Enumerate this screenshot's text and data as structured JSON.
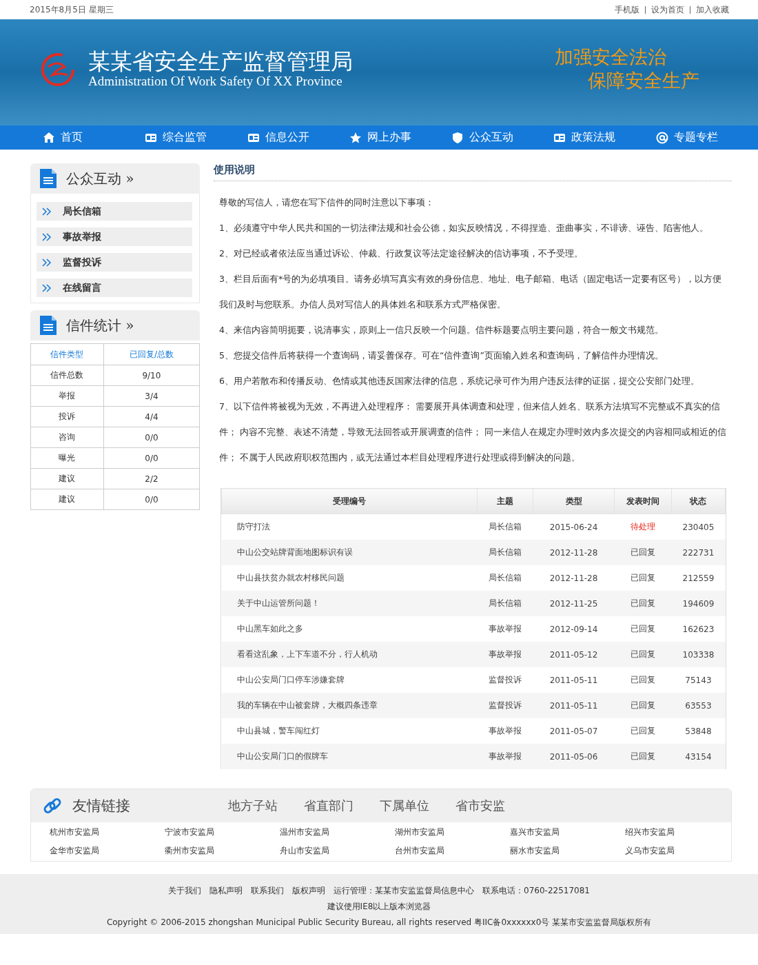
{
  "top_bar": {
    "date": "2015年8月5日 星期三",
    "links": [
      "手机版",
      "设为首页",
      "加入收藏"
    ]
  },
  "banner": {
    "title": "某某省安全生产监督管理局",
    "subtitle": "Administration Of Work Safety Of XX Province",
    "slogan": [
      "加强安全法治",
      "保障安全生产"
    ]
  },
  "nav": [
    {
      "label": "首页"
    },
    {
      "label": "综合监管"
    },
    {
      "label": "信息公开"
    },
    {
      "label": "网上办事"
    },
    {
      "label": "公众互动"
    },
    {
      "label": "政策法规"
    },
    {
      "label": "专题专栏"
    }
  ],
  "sidebar": {
    "menu_title": "公众互动 »",
    "menu": [
      "局长信箱",
      "事故举报",
      "监督投诉",
      "在线留言"
    ],
    "stats_title": "信件统计 »",
    "stats_columns": [
      "信件类型",
      "已回复/总数"
    ],
    "stats_rows": [
      [
        "信件总数",
        "9/10"
      ],
      [
        "举报",
        "3/4"
      ],
      [
        "投诉",
        "4/4"
      ],
      [
        "咨询",
        "0/0"
      ],
      [
        "曝光",
        "0/0"
      ],
      [
        "建议",
        "2/2"
      ],
      [
        "建议",
        "0/0"
      ]
    ]
  },
  "main": {
    "title": "使用说明",
    "paragraphs": [
      "尊敬的写信人，请您在写下信件的同时注意以下事项：",
      "1、必须遵守中华人民共和国的一切法律法规和社会公德，如实反映情况，不得捏造、歪曲事实，不诽谤、诬告、陷害他人。",
      "2、对已经或者依法应当通过诉讼、仲裁、行政复议等法定途径解决的信访事项，不予受理。",
      "3、栏目后面有*号的为必填项目。请务必填写真实有效的身份信息、地址、电子邮箱、电话（固定电话一定要有区号），以方便我们及时与您联系。办信人员对写信人的具体姓名和联系方式严格保密。",
      "4、来信内容简明扼要，说清事实，原则上一信只反映一个问题。信件标题要点明主要问题，符合一般文书规范。",
      "5、您提交信件后将获得一个查询码，请妥善保存。可在“信件查询”页面输入姓名和查询码，了解信件办理情况。",
      "6、用户若散布和传播反动、色情或其他违反国家法律的信息，系统记录可作为用户违反法律的证据，提交公安部门处理。",
      "7、以下信件将被视为无效，不再进入处理程序： 需要展开具体调查和处理，但来信人姓名、联系方法填写不完整或不真实的信件； 内容不完整、表述不清楚，导致无法回答或开展调查的信件； 同一来信人在规定办理时效内多次提交的内容相同或相近的信件； 不属于人民政府职权范围内，或无法通过本栏目处理程序进行处理或得到解决的问题。"
    ]
  },
  "table": {
    "columns": [
      "受理编号",
      "主题",
      "类型",
      "发表时间",
      "状态"
    ],
    "rows": [
      {
        "cells": [
          "防守打法",
          "局长信箱",
          "2015-06-24",
          "待处理",
          "230405"
        ],
        "pending": true
      },
      {
        "cells": [
          "中山公交站牌背面地图标识有误",
          "局长信箱",
          "2012-11-28",
          "已回复",
          "222731"
        ],
        "pending": false
      },
      {
        "cells": [
          "中山县扶贫办就农村移民问题",
          "局长信箱",
          "2012-11-28",
          "已回复",
          "212559"
        ],
        "pending": false
      },
      {
        "cells": [
          "关于中山运管所问题！",
          "局长信箱",
          "2012-11-25",
          "已回复",
          "194609"
        ],
        "pending": false
      },
      {
        "cells": [
          "中山黑车如此之多",
          "事故举报",
          "2012-09-14",
          "已回复",
          "162623"
        ],
        "pending": false
      },
      {
        "cells": [
          "看看这乱象，上下车道不分，行人机动",
          "事故举报",
          "2011-05-12",
          "已回复",
          "103338"
        ],
        "pending": false
      },
      {
        "cells": [
          "中山公安局门口停车涉嫌套牌",
          "监督投诉",
          "2011-05-11",
          "已回复",
          "75143"
        ],
        "pending": false
      },
      {
        "cells": [
          "我的车辆在中山被套牌，大概四条违章",
          "监督投诉",
          "2011-05-11",
          "已回复",
          "63553"
        ],
        "pending": false
      },
      {
        "cells": [
          "中山县城，警车闯红灯",
          "事故举报",
          "2011-05-07",
          "已回复",
          "53848"
        ],
        "pending": false
      },
      {
        "cells": [
          "中山公安局门口的假牌车",
          "事故举报",
          "2011-05-06",
          "已回复",
          "43154"
        ],
        "pending": false
      }
    ]
  },
  "links": {
    "title": "友情链接",
    "tabs": [
      "地方子站",
      "省直部门",
      "下属单位",
      "省市安监"
    ],
    "items": [
      "杭州市安监局",
      "宁波市安监局",
      "温州市安监局",
      "湖州市安监局",
      "嘉兴市安监局",
      "绍兴市安监局",
      "金华市安监局",
      "衢州市安监局",
      "舟山市安监局",
      "台州市安监局",
      "丽水市安监局",
      "义乌市安监局"
    ]
  },
  "footer": {
    "links": [
      "关于我们",
      "隐私声明",
      "联系我们",
      "版权声明"
    ],
    "operator": "运行管理：某某市安监监督局信息中心",
    "phone": "联系电话：0760-22517081",
    "browser_note": "建议使用IE8以上版本浏览器",
    "copyright": "Copyright © 2006-2015 zhongshan Municipal Public Security Bureau, all rights reserved 粤IIC备0xxxxxx0号 某某市安监监督局版权所有"
  }
}
